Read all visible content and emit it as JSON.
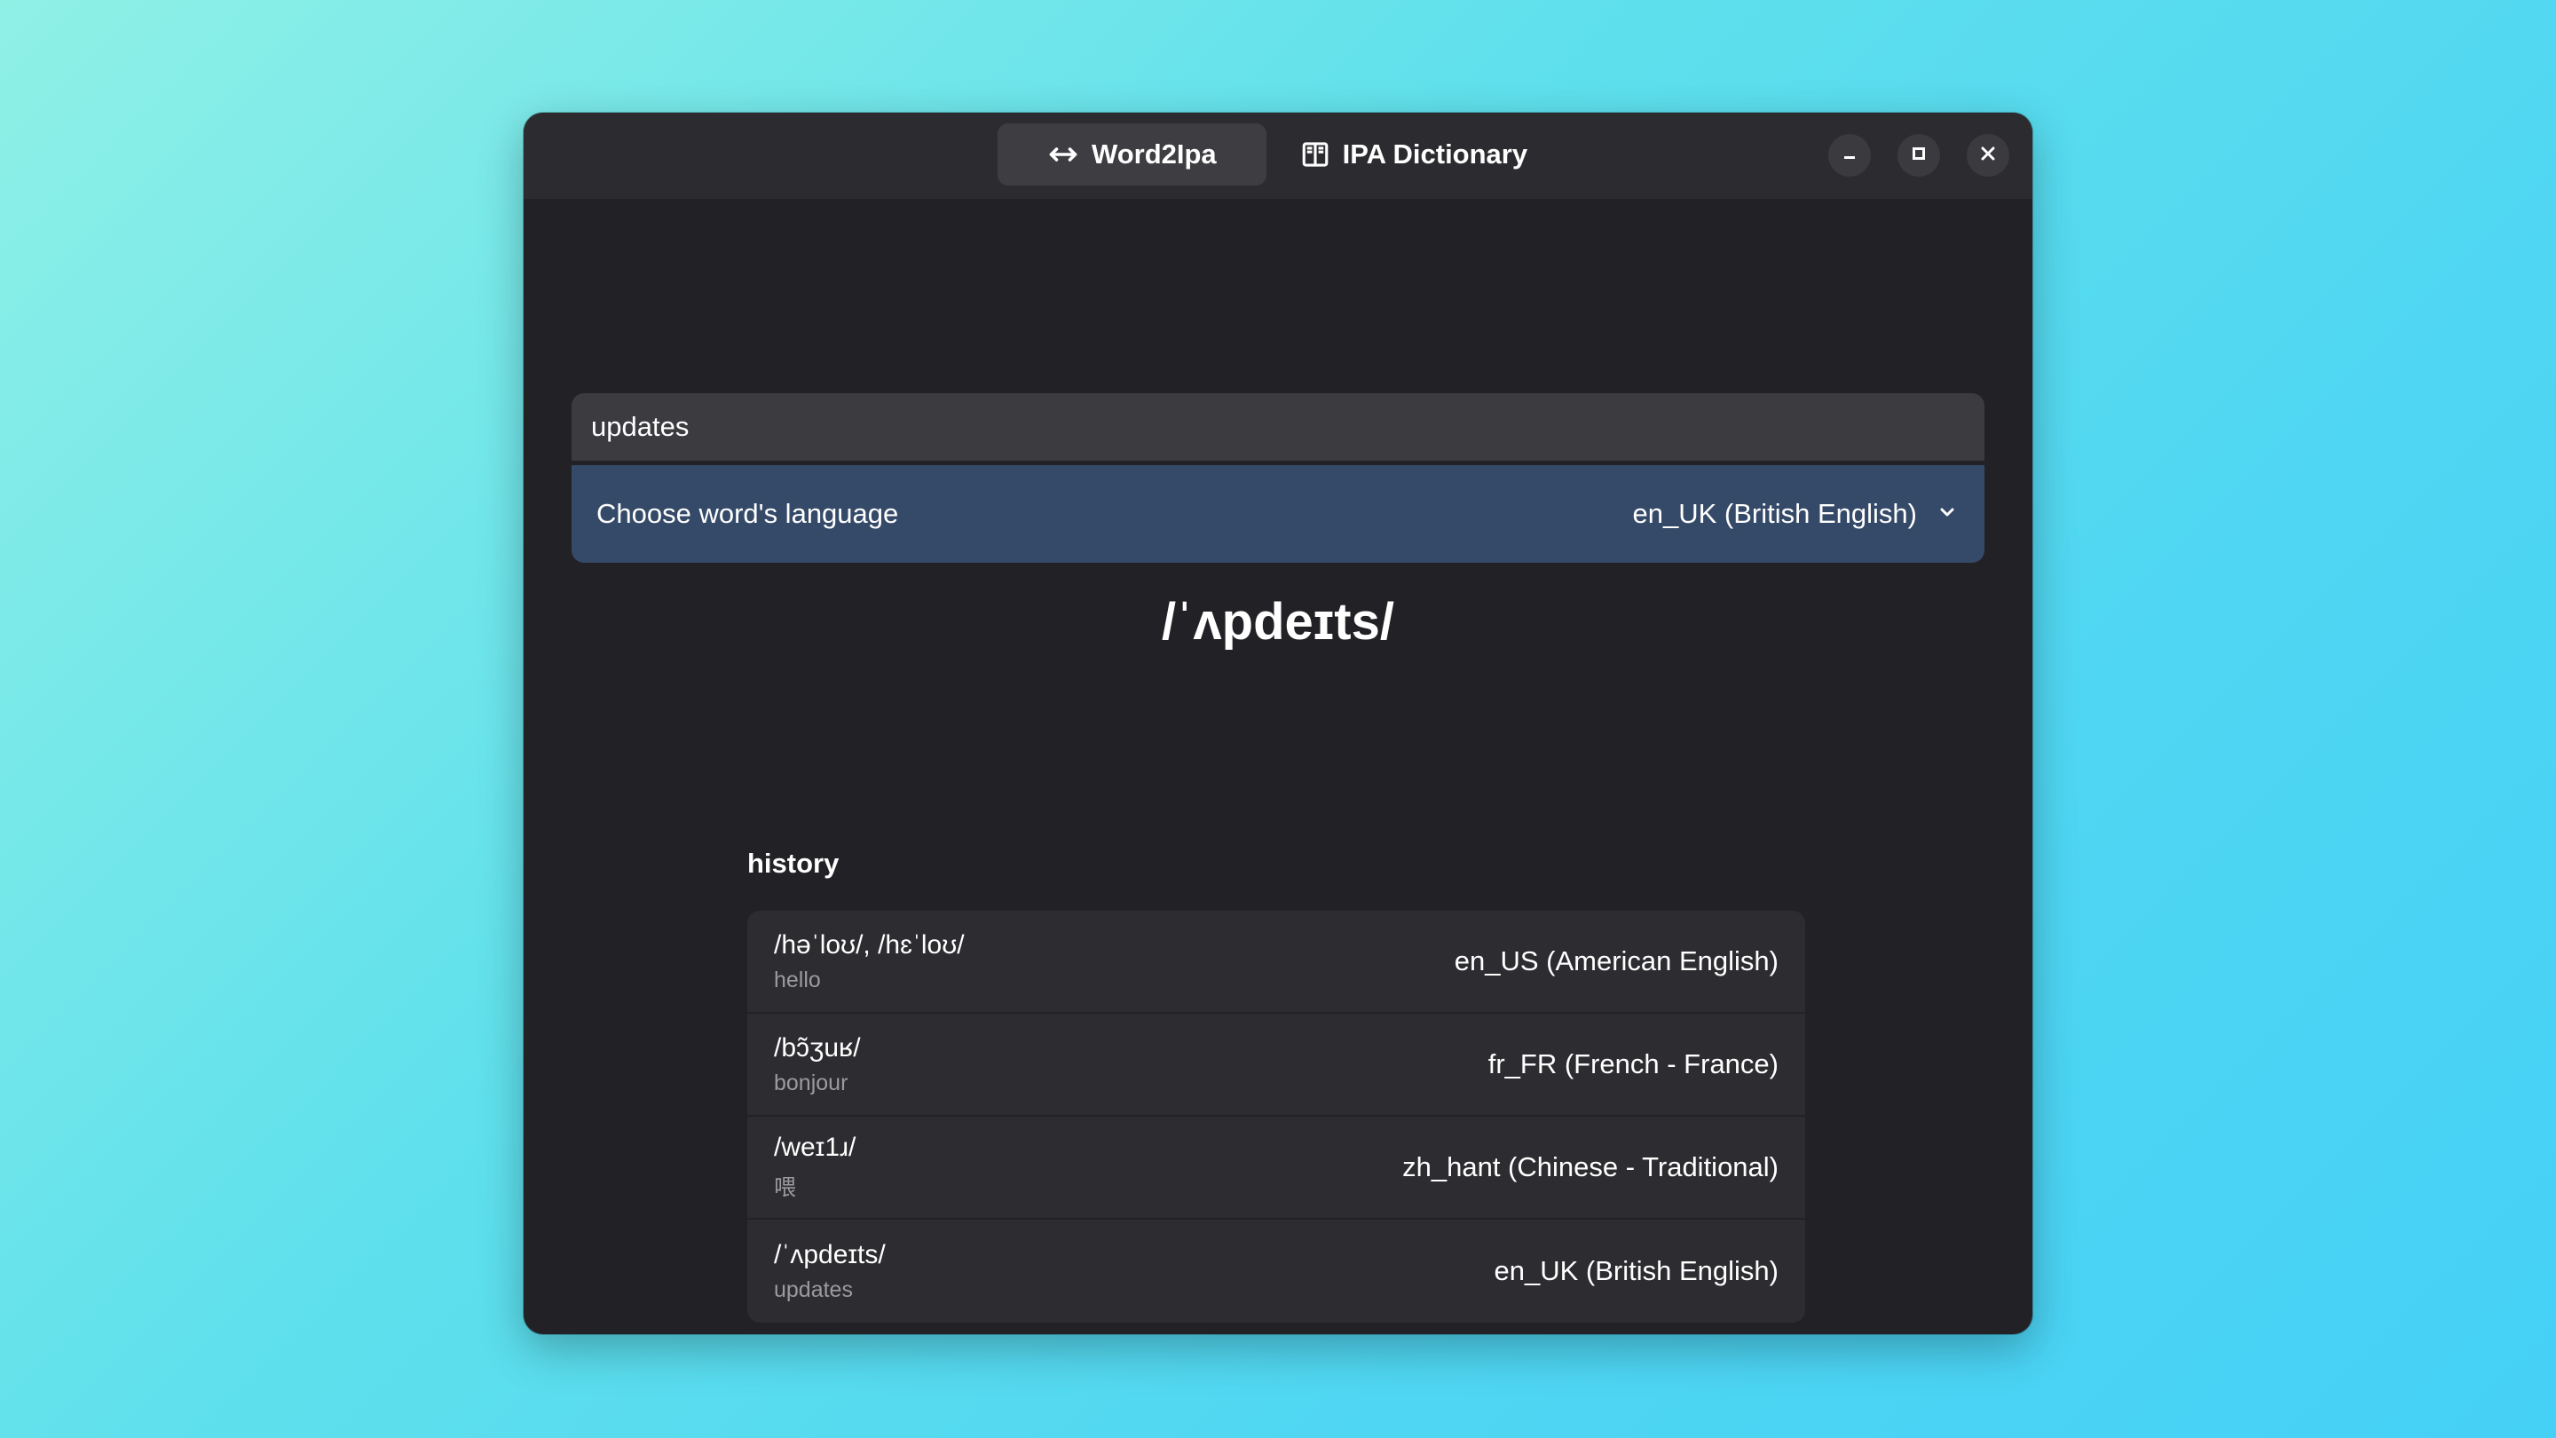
{
  "tabs": [
    {
      "label": "Word2Ipa",
      "icon": "swap-arrows-icon",
      "active": true
    },
    {
      "label": "IPA Dictionary",
      "icon": "book-icon",
      "active": false
    }
  ],
  "input": {
    "value": "updates"
  },
  "language": {
    "label": "Choose word's language",
    "selected": "en_UK (British English)"
  },
  "result": {
    "ipa": "/ˈʌpdeɪts/"
  },
  "history": {
    "title": "history",
    "items": [
      {
        "ipa": "/həˈloʊ/, /hɛˈloʊ/",
        "word": "hello",
        "lang": "en_US (American English)"
      },
      {
        "ipa": "/bɔ̃ʒuʁ/",
        "word": "bonjour",
        "lang": "fr_FR (French - France)"
      },
      {
        "ipa": "/weɪ1ɹ/",
        "word": "喂",
        "lang": "zh_hant (Chinese - Traditional)"
      },
      {
        "ipa": "/ˈʌpdeɪts/",
        "word": "updates",
        "lang": "en_UK (British English)"
      }
    ]
  },
  "colors": {
    "window_bg": "#222226",
    "titlebar_bg": "#2c2c30",
    "accent_row": "#354a68",
    "input_bg": "#3b3b40"
  }
}
